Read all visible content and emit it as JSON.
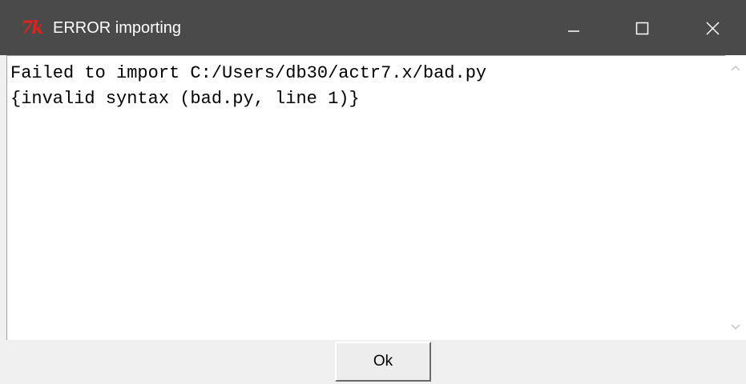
{
  "window": {
    "title": "ERROR importing",
    "app_icon": "tk-feather-icon",
    "app_icon_text": "7k",
    "controls": {
      "minimize_icon": "minimize-icon",
      "maximize_icon": "maximize-icon",
      "close_icon": "close-icon"
    }
  },
  "message": {
    "lines": [
      "Failed to import C:/Users/db30/actr7.x/bad.py",
      "{invalid syntax (bad.py, line 1)}"
    ]
  },
  "buttons": {
    "ok_label": "Ok"
  },
  "colors": {
    "titlebar": "#4a4a4a",
    "logo": "#e0211c",
    "text_area": "#ffffff",
    "background": "#f0f0f0"
  }
}
